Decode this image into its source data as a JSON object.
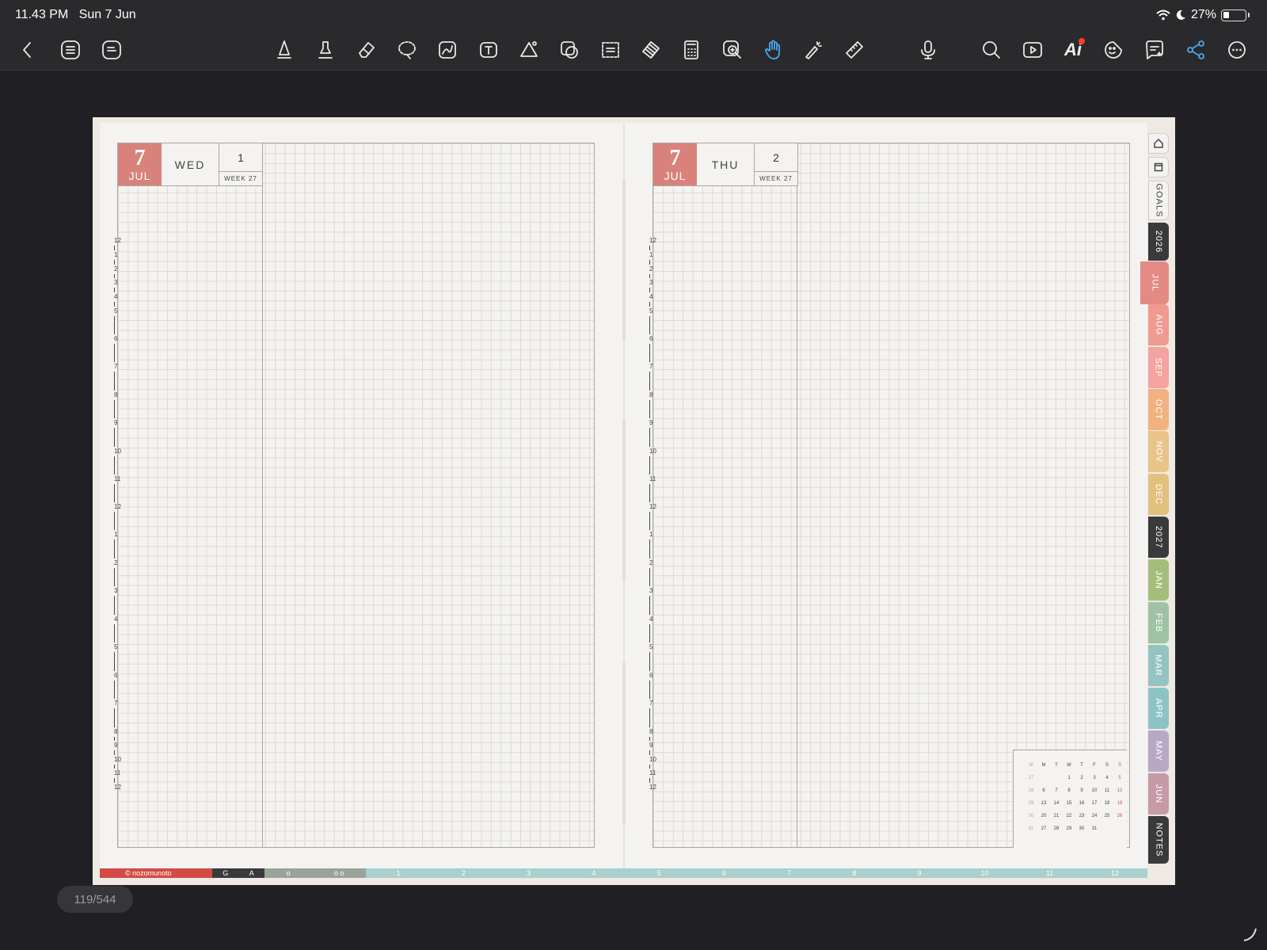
{
  "status_bar": {
    "time": "11.43 PM",
    "date": "Sun 7 Jun",
    "battery": "27%",
    "battery_level": 0.27
  },
  "toolbar": {
    "left": [
      "back-icon",
      "outline-list-icon",
      "page-list-icon"
    ],
    "tools": [
      "pen-icon",
      "highlighter-icon",
      "eraser-icon",
      "lasso-icon",
      "image-icon",
      "text-icon",
      "shapes-icon",
      "elements-icon",
      "selection-icon",
      "tape-icon",
      "calculator-icon",
      "zoom-window-icon",
      "hand-icon",
      "laser-pointer-icon",
      "ruler-icon"
    ],
    "right": [
      "microphone-icon",
      "search-icon",
      "presentation-icon",
      "ai-icon",
      "sticker-icon",
      "comment-icon",
      "share-icon",
      "more-icon"
    ],
    "ai_label": "Ai",
    "active_tool": "hand-icon",
    "accent": "#4aa8f0"
  },
  "left_page": {
    "day": "7",
    "month": "JUL",
    "weekday": "WED",
    "date_num": "1",
    "week": "WEEK 27"
  },
  "right_page": {
    "day": "7",
    "month": "JUL",
    "weekday": "THU",
    "date_num": "2",
    "week": "WEEK 27"
  },
  "time_labels": [
    "12",
    "1",
    "2",
    "3",
    "4",
    "5",
    "6",
    "7",
    "8",
    "9",
    "10",
    "11",
    "12",
    "1",
    "2",
    "3",
    "4",
    "5",
    "6",
    "7",
    "8",
    "9",
    "10",
    "11",
    "12"
  ],
  "mini_calendar": {
    "header": [
      "W",
      "M",
      "T",
      "W",
      "T",
      "F",
      "S",
      "S"
    ],
    "rows": [
      [
        "27",
        "",
        "",
        "1",
        "2",
        "3",
        "4",
        "5"
      ],
      [
        "28",
        "6",
        "7",
        "8",
        "9",
        "10",
        "11",
        "12"
      ],
      [
        "29",
        "13",
        "14",
        "15",
        "16",
        "17",
        "18",
        "19"
      ],
      [
        "30",
        "20",
        "21",
        "22",
        "23",
        "24",
        "25",
        "26"
      ],
      [
        "31",
        "27",
        "28",
        "29",
        "30",
        "31",
        "",
        ""
      ]
    ]
  },
  "tabs": [
    {
      "label": "",
      "icon": "home-icon",
      "color": "#f4f3f1",
      "light": true
    },
    {
      "label": "",
      "icon": "index-icon",
      "color": "#f4f3f1",
      "light": true
    },
    {
      "label": "GOALS",
      "color": "#f4f3f1",
      "light": true
    },
    {
      "label": "2026",
      "color": "#3a3a3c"
    },
    {
      "label": "JUL",
      "color": "#e28a83",
      "active": true
    },
    {
      "label": "AUG",
      "color": "#f09a92"
    },
    {
      "label": "SEP",
      "color": "#f5a3a0"
    },
    {
      "label": "OCT",
      "color": "#f2b27f"
    },
    {
      "label": "NOV",
      "color": "#e8c48a"
    },
    {
      "label": "DEC",
      "color": "#e2c07e"
    },
    {
      "label": "2027",
      "color": "#3a3a3c"
    },
    {
      "label": "JAN",
      "color": "#a5bd7b"
    },
    {
      "label": "FEB",
      "color": "#9fc2a4"
    },
    {
      "label": "MAR",
      "color": "#95c3c0"
    },
    {
      "label": "APR",
      "color": "#8ec3c6"
    },
    {
      "label": "MAY",
      "color": "#b7a9c6"
    },
    {
      "label": "JUN",
      "color": "#c79aa8"
    },
    {
      "label": "NOTES",
      "color": "#3a3a3c"
    }
  ],
  "bottom_strip": {
    "copyright": "© nozomunoto",
    "letters": [
      "G",
      "A"
    ],
    "circles": [
      "o",
      "o o"
    ],
    "numbers": [
      "1",
      "2",
      "3",
      "4",
      "5",
      "6",
      "7",
      "8",
      "9",
      "10",
      "11",
      "12"
    ]
  },
  "page_indicator": "119/544"
}
